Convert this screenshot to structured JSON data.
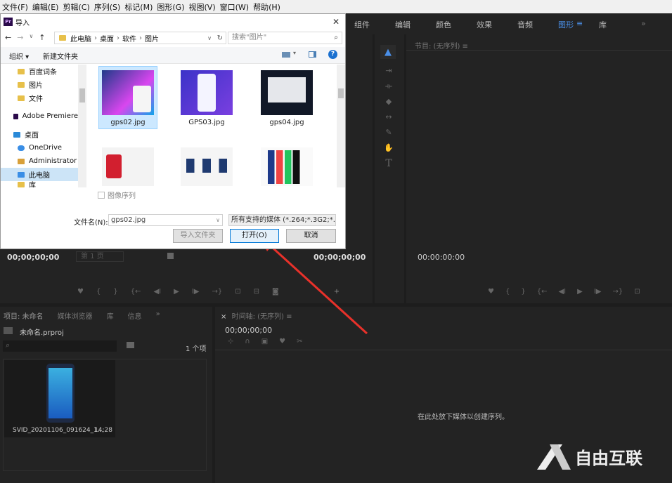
{
  "menu": [
    "文件(F)",
    "编辑(E)",
    "剪辑(C)",
    "序列(S)",
    "标记(M)",
    "图形(G)",
    "视图(V)",
    "窗口(W)",
    "帮助(H)"
  ],
  "workspaces": {
    "items": [
      "组件",
      "编辑",
      "颜色",
      "效果",
      "音频",
      "图形",
      "库"
    ],
    "active": "图形",
    "more": "»"
  },
  "dialog": {
    "logo": "Pr",
    "title": "导入",
    "close": "✕",
    "breadcrumb": [
      "此电脑",
      "桌面",
      "软件",
      "图片"
    ],
    "search_placeholder": "搜索\"图片\"",
    "organize": "组织 ▾",
    "new_folder": "新建文件夹",
    "nav_items": [
      "百度词条",
      "图片",
      "文件",
      "Adobe Premiere",
      "桌面",
      "OneDrive",
      "Administrator",
      "此电脑",
      "库"
    ],
    "files": [
      "gps02.jpg",
      "GPS03.jpg",
      "gps04.jpg",
      "",
      "",
      ""
    ],
    "image_sequence": "图像序列",
    "filename_label": "文件名(N):",
    "filename_value": "gps02.jpg",
    "filetype": "所有支持的媒体 (*.264;*.3G2;*.",
    "import_folder": "导入文件夹",
    "open": "打开(O)",
    "cancel": "取消"
  },
  "source_monitor": {
    "timecode_left": "00;00;00;00",
    "page": "第 1 页",
    "timecode_right": "00;00;00;00"
  },
  "program_monitor": {
    "title": "节目: (无序列)",
    "menu": "≡",
    "timecode": "00:00:00:00"
  },
  "project": {
    "tabs": [
      "项目: 未命名",
      "媒体浏览器",
      "库",
      "信息"
    ],
    "file": "未命名.prproj",
    "count": "1 个项",
    "clip_name": "SVID_20201106_091624_1...",
    "clip_duration": "14;28"
  },
  "timeline": {
    "title": "时间轴: (无序列)",
    "close": "×",
    "timecode": "00;00;00;00",
    "empty_msg": "在此处放下媒体以创建序列。"
  },
  "watermark": "自由互联"
}
